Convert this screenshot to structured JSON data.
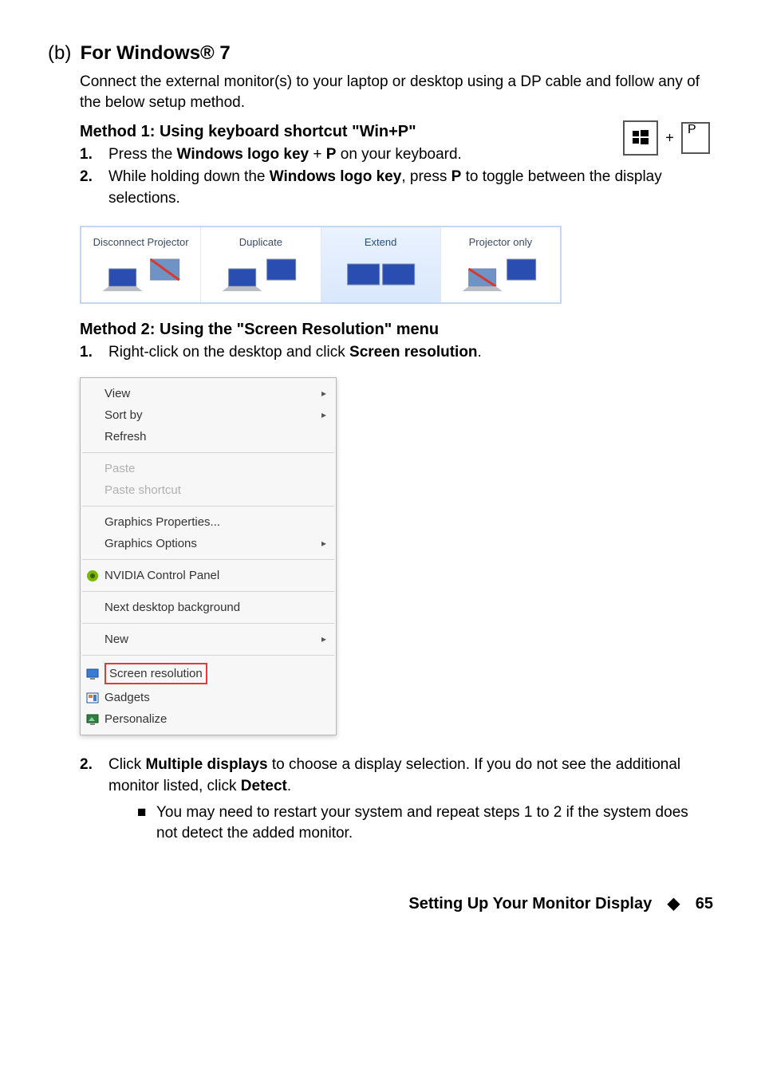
{
  "header": {
    "letter": "(b)",
    "title": "For Windows® 7"
  },
  "intro": "Connect the external monitor(s) to your laptop or desktop using a DP cable and follow any of the below setup method.",
  "method1": {
    "heading": "Method 1: Using keyboard shortcut \"Win+P\"",
    "p_key_label": "P",
    "step1": {
      "num": "1.",
      "pre": "Press the ",
      "key1": "Windows logo key",
      "plus": " + ",
      "key2": "P",
      "post": " on your keyboard."
    },
    "step2": {
      "num": "2.",
      "pre": "While holding down the ",
      "key1": "Windows logo key",
      "mid": ", press ",
      "key2": "P",
      "post": " to toggle between the display selections."
    }
  },
  "projector": {
    "options": [
      "Disconnect Projector",
      "Duplicate",
      "Extend",
      "Projector only"
    ]
  },
  "method2": {
    "heading": "Method 2: Using the \"Screen Resolution\" menu",
    "step1": {
      "num": "1.",
      "pre": "Right-click on the desktop and click ",
      "bold": "Screen resolution",
      "post": "."
    },
    "step2": {
      "num": "2.",
      "pre": "Click ",
      "bold1": "Multiple displays",
      "mid": " to choose a display selection. If you do not see the additional monitor listed, click ",
      "bold2": "Detect",
      "post": "."
    },
    "bullet": "You may need to restart your system and repeat steps 1 to 2 if the system does not detect the added monitor."
  },
  "context_menu": {
    "view": "View",
    "sort_by": "Sort by",
    "refresh": "Refresh",
    "paste": "Paste",
    "paste_shortcut": "Paste shortcut",
    "graphics_properties": "Graphics Properties...",
    "graphics_options": "Graphics Options",
    "nvidia": "NVIDIA Control Panel",
    "next_bg": "Next desktop background",
    "new": "New",
    "screen_resolution": "Screen resolution",
    "gadgets": "Gadgets",
    "personalize": "Personalize"
  },
  "footer": {
    "text": "Setting Up Your Monitor Display",
    "page": "65"
  }
}
